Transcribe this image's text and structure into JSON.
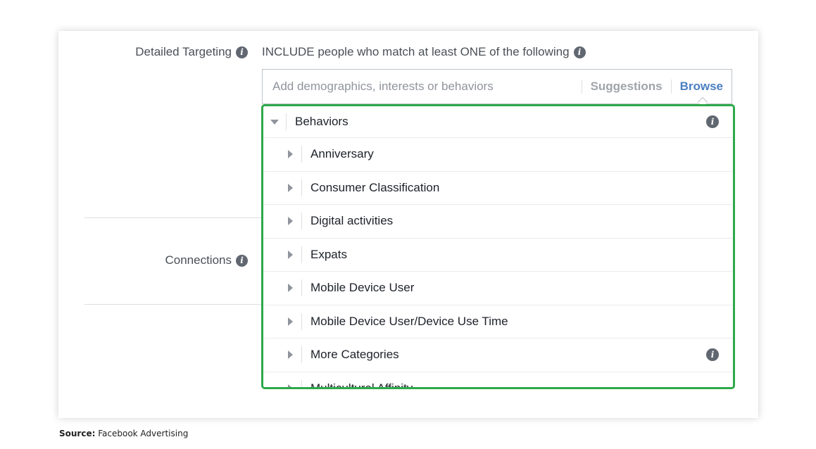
{
  "detailed_targeting": {
    "label": "Detailed Targeting",
    "include_text": "INCLUDE people who match at least ONE of the following"
  },
  "connections": {
    "label": "Connections"
  },
  "search": {
    "placeholder": "Add demographics, interests or behaviors",
    "suggestions_label": "Suggestions",
    "browse_label": "Browse"
  },
  "dropdown": {
    "header_label": "Behaviors",
    "items": [
      {
        "label": "Anniversary",
        "has_info": false
      },
      {
        "label": "Consumer Classification",
        "has_info": false
      },
      {
        "label": "Digital activities",
        "has_info": false
      },
      {
        "label": "Expats",
        "has_info": false
      },
      {
        "label": "Mobile Device User",
        "has_info": false
      },
      {
        "label": "Mobile Device User/Device Use Time",
        "has_info": false
      },
      {
        "label": "More Categories",
        "has_info": true
      },
      {
        "label": "Multicultural Affinity",
        "has_info": false
      }
    ]
  },
  "source": {
    "prefix": "Source:",
    "text": "Facebook Advertising"
  },
  "colors": {
    "highlight_border": "#2ea84a",
    "browse_link": "#4a7fc1",
    "info_icon": "#606770"
  }
}
